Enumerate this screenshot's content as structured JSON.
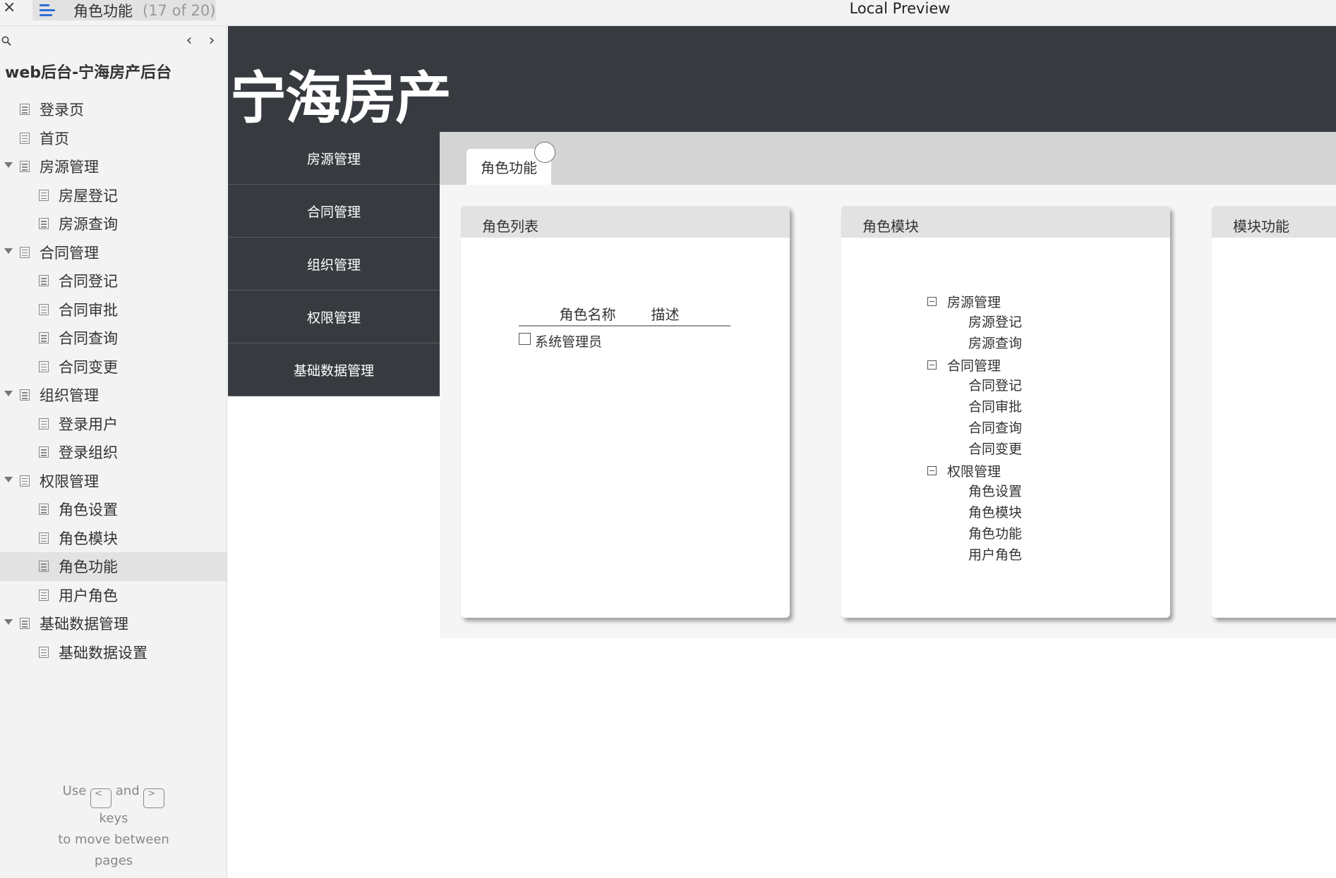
{
  "topbar": {
    "close": "×",
    "page_title": "角色功能",
    "page_count": "(17 of 20)",
    "window_title": "Local Preview"
  },
  "sidebar": {
    "project_title": "web后台-宁海房产后台",
    "prev": "‹",
    "next": "›",
    "items": [
      {
        "label": "登录页",
        "level": 1
      },
      {
        "label": "首页",
        "level": 1
      },
      {
        "label": "房源管理",
        "level": 1
      },
      {
        "label": "房屋登记",
        "level": 2
      },
      {
        "label": "房源查询",
        "level": 2
      },
      {
        "label": "合同管理",
        "level": 1
      },
      {
        "label": "合同登记",
        "level": 2
      },
      {
        "label": "合同审批",
        "level": 2
      },
      {
        "label": "合同查询",
        "level": 2
      },
      {
        "label": "合同变更",
        "level": 2
      },
      {
        "label": "组织管理",
        "level": 1
      },
      {
        "label": "登录用户",
        "level": 2
      },
      {
        "label": "登录组织",
        "level": 2
      },
      {
        "label": "权限管理",
        "level": 1
      },
      {
        "label": "角色设置",
        "level": 2
      },
      {
        "label": "角色模块",
        "level": 2
      },
      {
        "label": "角色功能",
        "level": 2
      },
      {
        "label": "用户角色",
        "level": 2
      },
      {
        "label": "基础数据管理",
        "level": 1
      },
      {
        "label": "基础数据设置",
        "level": 2
      }
    ],
    "help": {
      "use": "Use",
      "key_prev": "<",
      "and": "and",
      "key_next": ">",
      "keys": "keys",
      "line2": "to move between",
      "line3": "pages"
    }
  },
  "app": {
    "brand": "宁海房产",
    "nav": [
      "房源管理",
      "合同管理",
      "组织管理",
      "权限管理",
      "基础数据管理"
    ],
    "active_tab": "角色功能",
    "panels": {
      "roles": {
        "title": "角色列表",
        "col_name": "角色名称",
        "col_desc": "描述",
        "row_name": "系统管理员"
      },
      "modules": {
        "title": "角色模块",
        "groups": [
          {
            "name": "房源管理",
            "children": [
              "房源登记",
              "房源查询"
            ]
          },
          {
            "name": "合同管理",
            "children": [
              "合同登记",
              "合同审批",
              "合同查询",
              "合同变更"
            ]
          },
          {
            "name": "权限管理",
            "children": [
              "角色设置",
              "角色模块",
              "角色功能",
              "用户角色"
            ]
          }
        ]
      },
      "functions": {
        "title": "模块功能"
      }
    }
  }
}
